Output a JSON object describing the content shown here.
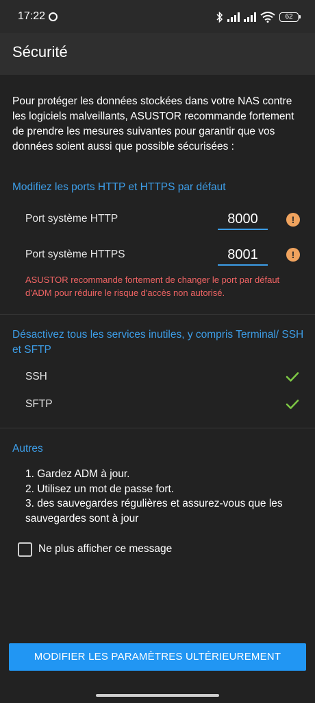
{
  "status_bar": {
    "time": "17:22",
    "battery": "62",
    "icons": [
      "circle-icon",
      "bluetooth-icon",
      "signal-icon",
      "signal-icon",
      "wifi-icon",
      "battery-icon"
    ]
  },
  "app_bar": {
    "title": "Sécurité"
  },
  "intro": "Pour protéger les données stockées dans votre NAS contre les logiciels malveillants, ASUSTOR recommande fortement de prendre les mesures suivantes pour garantir que vos données soient aussi  que possible sécurisées  :",
  "ports_section": {
    "title": "Modifiez les ports HTTP et HTTPS par défaut",
    "http_label": "Port système HTTP",
    "http_value": "8000",
    "https_label": "Port système HTTPS",
    "https_value": "8001",
    "warning": "ASUSTOR recommande fortement de changer le port par défaut d'ADM pour réduire le risque d'accès non autorisé."
  },
  "services_section": {
    "title": "Désactivez tous les services inutiles, y compris Terminal/ SSH et SFTP",
    "items": [
      {
        "label": "SSH"
      },
      {
        "label": "SFTP"
      }
    ]
  },
  "other_section": {
    "title": "Autres",
    "items": [
      "1. Gardez ADM à jour.",
      "2. Utilisez un mot de passe fort.",
      "3. des sauvegardes régulières et assurez-vous que les sauvegardes sont à jour"
    ]
  },
  "dont_show": {
    "label": "Ne plus afficher ce message",
    "checked": false
  },
  "primary_button": {
    "label": "MODIFIER LES PARAMÈTRES ULTÉRIEUREMENT"
  },
  "colors": {
    "accent": "#2196f3",
    "link": "#3d9ee8",
    "warning": "#f06464",
    "warning_icon": "#f0a35e",
    "check": "#7cc644"
  }
}
